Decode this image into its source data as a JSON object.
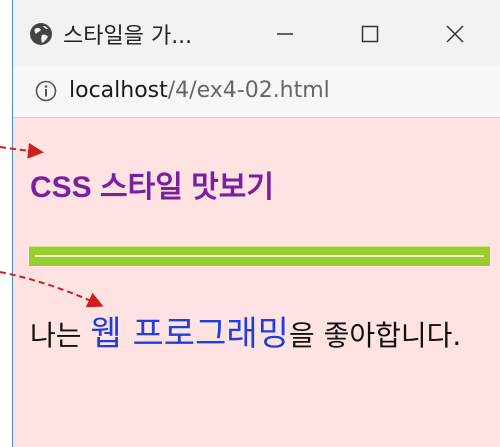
{
  "browser": {
    "tab_title": "스타일을 가...",
    "minimize_symbol": "—",
    "maximize_symbol": "☐",
    "close_symbol": "✕",
    "url_host": "localhost",
    "url_path": "/4/ex4-02.html",
    "tab_icon": "globe-icon",
    "address_icon": "info-icon"
  },
  "page": {
    "title": "CSS 스타일 맛보기",
    "paragraph_before": "나는 ",
    "paragraph_highlight": "웹 프로그래밍",
    "paragraph_after": "을 좋아합니다."
  },
  "colors": {
    "page_background": "#ffe3e3",
    "title_color": "#7b1fa2",
    "rule_color": "#9acd32",
    "highlight_color": "#1f3fdc",
    "annotation_arrow": "#cc1f1f"
  }
}
